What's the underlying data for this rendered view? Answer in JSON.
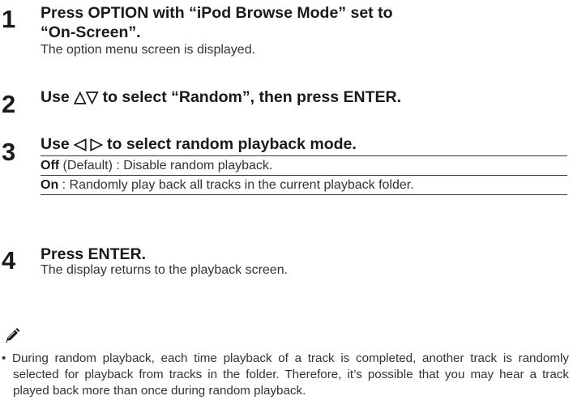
{
  "steps": [
    {
      "number": "1",
      "title_line1": "Press OPTION with “iPod Browse Mode” set to",
      "title_line2": "“On-Screen”.",
      "description": "The option menu screen is displayed."
    },
    {
      "number": "2",
      "title": "Use △▽ to select “Random”, then press ENTER."
    },
    {
      "number": "3",
      "title": "Use ◁ ▷ to select random playback mode.",
      "options": [
        {
          "label": "Off",
          "text": " (Default) : Disable random playback."
        },
        {
          "label": "On",
          "text": " : Randomly play back all tracks in the current playback folder."
        }
      ]
    },
    {
      "number": "4",
      "title": "Press ENTER.",
      "description": "The display returns to the playback screen."
    }
  ],
  "note": {
    "icon": "pencil-memo-icon",
    "text": "• During random playback, each time playback of a track is completed, another track is randomly selected for playback from tracks in the folder. Therefore, it’s possible that you may hear a track played back more than once during random playback."
  }
}
